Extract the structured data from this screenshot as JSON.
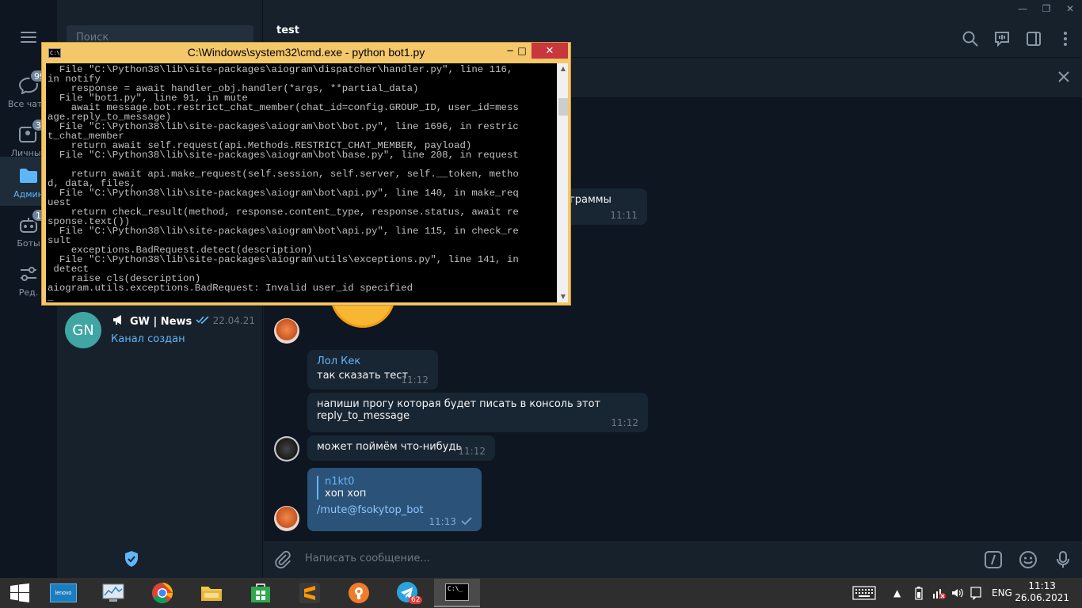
{
  "folders": [
    {
      "label": "Все чаты",
      "badge": "99"
    },
    {
      "label": "Личные",
      "badge": "3"
    },
    {
      "label": "Админ",
      "badge": ""
    },
    {
      "label": "Боты",
      "badge": "16"
    },
    {
      "label": "Ред.",
      "badge": ""
    }
  ],
  "search": {
    "placeholder": "Поиск"
  },
  "chatlist": {
    "item": {
      "initials": "GN",
      "title": "GW | News",
      "date": "22.04.21",
      "preview": "Канал создан"
    }
  },
  "header": {
    "title": "test"
  },
  "messages": {
    "partial_text": "ограммы",
    "partial_time": "11:11",
    "m1": {
      "sender": "Лол Кек",
      "text": "так сказать тест",
      "time": "11:12"
    },
    "m2": {
      "line1": "напиши прогу которая будет писать в консоль этот",
      "line2": "reply_to_message",
      "time": "11:12"
    },
    "m3": {
      "text": "может поймём что-нибудь",
      "time": "11:12"
    },
    "m4": {
      "reply_name": "n1kt0",
      "reply_text": "хоп хоп",
      "text": "/mute@fsokytop_bot",
      "time": "11:13"
    }
  },
  "composer": {
    "placeholder": "Написать сообщение..."
  },
  "cmd": {
    "title": "C:\\Windows\\system32\\cmd.exe - python  bot1.py",
    "output": "  File \"C:\\Python38\\lib\\site-packages\\aiogram\\dispatcher\\handler.py\", line 116,\nin notify\n    response = await handler_obj.handler(*args, **partial_data)\n  File \"bot1.py\", line 91, in mute\n    await message.bot.restrict_chat_member(chat_id=config.GROUP_ID, user_id=mess\nage.reply_to_message)\n  File \"C:\\Python38\\lib\\site-packages\\aiogram\\bot\\bot.py\", line 1696, in restric\nt_chat_member\n    return await self.request(api.Methods.RESTRICT_CHAT_MEMBER, payload)\n  File \"C:\\Python38\\lib\\site-packages\\aiogram\\bot\\base.py\", line 208, in request\n\n    return await api.make_request(self.session, self.server, self.__token, metho\nd, data, files,\n  File \"C:\\Python38\\lib\\site-packages\\aiogram\\bot\\api.py\", line 140, in make_req\nuest\n    return check_result(method, response.content_type, response.status, await re\nsponse.text())\n  File \"C:\\Python38\\lib\\site-packages\\aiogram\\bot\\api.py\", line 115, in check_re\nsult\n    exceptions.BadRequest.detect(description)\n  File \"C:\\Python38\\lib\\site-packages\\aiogram\\utils\\exceptions.py\", line 141, in\n detect\n    raise cls(description)\naiogram.utils.exceptions.BadRequest: Invalid user_id specified\n_"
  },
  "taskbar": {
    "lenovo_label": "lenovo",
    "telegram_badge": "62",
    "lang": "ENG",
    "time": "11:13",
    "date": "26.06.2021"
  },
  "colors": {
    "accent": "#5eb5f7",
    "bg": "#0e1621",
    "panel": "#17212b",
    "out_bubble": "#2b5278"
  }
}
